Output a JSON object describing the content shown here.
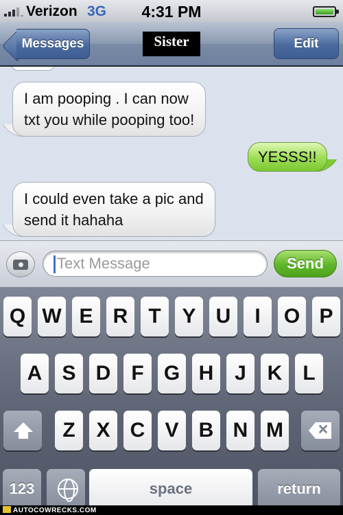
{
  "status_bar": {
    "carrier": "Verizon",
    "network": "3G",
    "time": "4:31 PM",
    "battery_level": 1.0
  },
  "nav": {
    "back_label": "Messages",
    "title": "Sister",
    "edit_label": "Edit"
  },
  "messages": [
    {
      "direction": "incoming",
      "text_lines": [
        "I am pooping . I can now",
        "txt you while pooping too!"
      ]
    },
    {
      "direction": "outgoing",
      "text_lines": [
        "YESSS!!"
      ]
    },
    {
      "direction": "incoming",
      "text_lines": [
        "I could even take a pic and",
        "send it hahaha"
      ]
    }
  ],
  "input": {
    "placeholder": "Text Message",
    "send_label": "Send"
  },
  "keyboard": {
    "row1": [
      "Q",
      "W",
      "E",
      "R",
      "T",
      "Y",
      "U",
      "I",
      "O",
      "P"
    ],
    "row2": [
      "A",
      "S",
      "D",
      "F",
      "G",
      "H",
      "J",
      "K",
      "L"
    ],
    "row3": [
      "Z",
      "X",
      "C",
      "V",
      "B",
      "N",
      "M"
    ],
    "numbers_label": "123",
    "space_label": "space",
    "return_label": "return"
  },
  "watermark": "AUTOCOWRECKS.COM",
  "colors": {
    "incoming_bubble": "#ffffff",
    "outgoing_bubble": "#8fd444",
    "chat_background": "#dbe1ed",
    "send_button": "#5fb52a",
    "nav_button": "#4a6a9e"
  }
}
